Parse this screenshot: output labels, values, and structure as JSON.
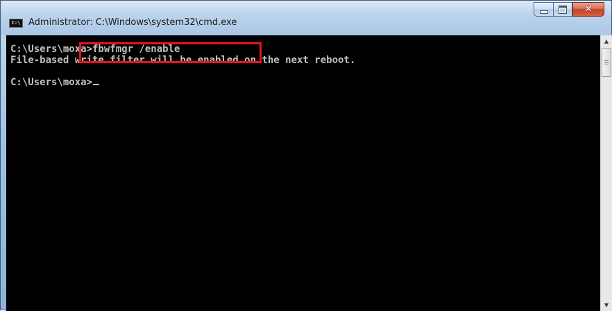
{
  "window": {
    "title": "Administrator: C:\\Windows\\system32\\cmd.exe",
    "icon": "cmd-icon",
    "icon_text": "C:\\",
    "buttons": {
      "minimize_icon": "minimize-icon",
      "maximize_icon": "maximize-icon",
      "close_icon": "close-icon",
      "close_glyph": "✕"
    }
  },
  "console": {
    "lines": [
      "C:\\Users\\moxa>fbwfmgr /enable",
      "File-based write filter will be enabled on the next reboot.",
      "",
      "C:\\Users\\moxa>"
    ],
    "text_color": "#c0c0c0",
    "background": "#000000"
  },
  "annotation": {
    "color": "#e8141a"
  },
  "scrollbar": {
    "up_arrow": "▲",
    "down_arrow": "▼"
  }
}
